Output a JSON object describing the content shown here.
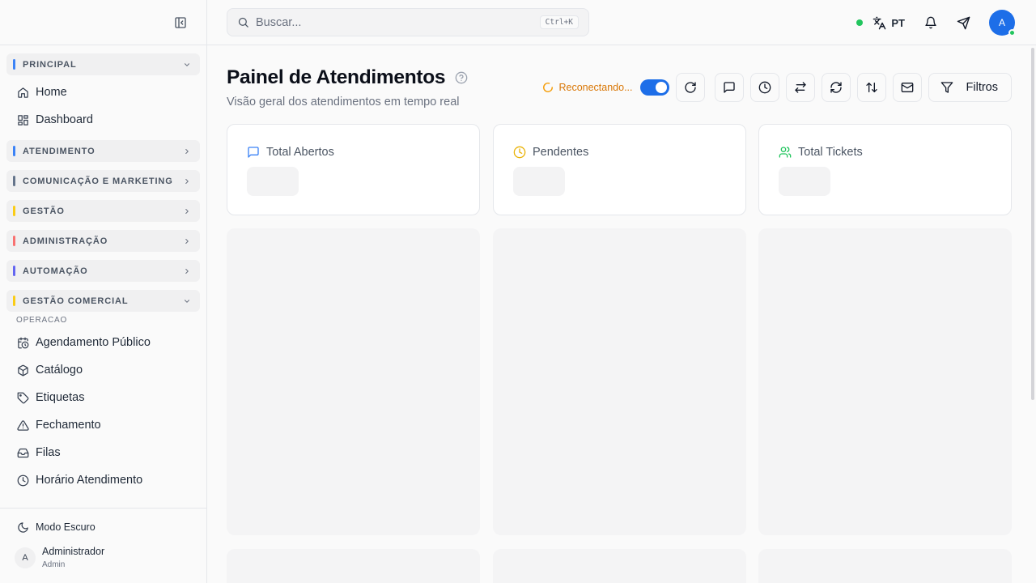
{
  "sidebar": {
    "groups": {
      "principal": {
        "label": "PRINCIPAL",
        "color": "#3b82f6"
      },
      "atendimento": {
        "label": "ATENDIMENTO",
        "color": "#3b82f6"
      },
      "comunicacao": {
        "label": "COMUNICAÇÃO E MARKETING",
        "color": "#64748b"
      },
      "gestao": {
        "label": "GESTÃO",
        "color": "#facc15"
      },
      "administracao": {
        "label": "ADMINISTRAÇÃO",
        "color": "#f87171"
      },
      "automacao": {
        "label": "AUTOMAÇÃO",
        "color": "#6366f1"
      },
      "gestao_comercial": {
        "label": "GESTÃO COMERCIAL",
        "color": "#facc15"
      }
    },
    "principal_items": [
      {
        "label": "Home",
        "icon": "home-icon"
      },
      {
        "label": "Dashboard",
        "icon": "dashboard-icon"
      }
    ],
    "subsection_label": "OPERACAO",
    "comercial_items": [
      {
        "label": "Agendamento Público",
        "icon": "calendar-clock-icon"
      },
      {
        "label": "Catálogo",
        "icon": "package-icon"
      },
      {
        "label": "Etiquetas",
        "icon": "tag-icon"
      },
      {
        "label": "Fechamento",
        "icon": "alert-triangle-icon"
      },
      {
        "label": "Filas",
        "icon": "inbox-icon"
      },
      {
        "label": "Horário Atendimento",
        "icon": "clock-icon"
      }
    ],
    "dark_mode_label": "Modo Escuro",
    "user": {
      "initial": "A",
      "name": "Administrador",
      "role": "Admin"
    }
  },
  "header": {
    "search_placeholder": "Buscar...",
    "shortcut": "Ctrl+K",
    "language": "PT",
    "avatar_initial": "A"
  },
  "page": {
    "title": "Painel de Atendimentos",
    "subtitle": "Visão geral dos atendimentos em tempo real",
    "connection_status": "Reconectando...",
    "filters_label": "Filtros"
  },
  "stats": [
    {
      "label": "Total Abertos",
      "icon": "message-square-icon",
      "color": "#3b82f6"
    },
    {
      "label": "Pendentes",
      "icon": "clock-icon",
      "color": "#eab308"
    },
    {
      "label": "Total Tickets",
      "icon": "users-icon",
      "color": "#22c55e"
    }
  ],
  "colors": {
    "accent": "#1d6ee8",
    "online": "#22c55e",
    "warning": "#d97706"
  }
}
